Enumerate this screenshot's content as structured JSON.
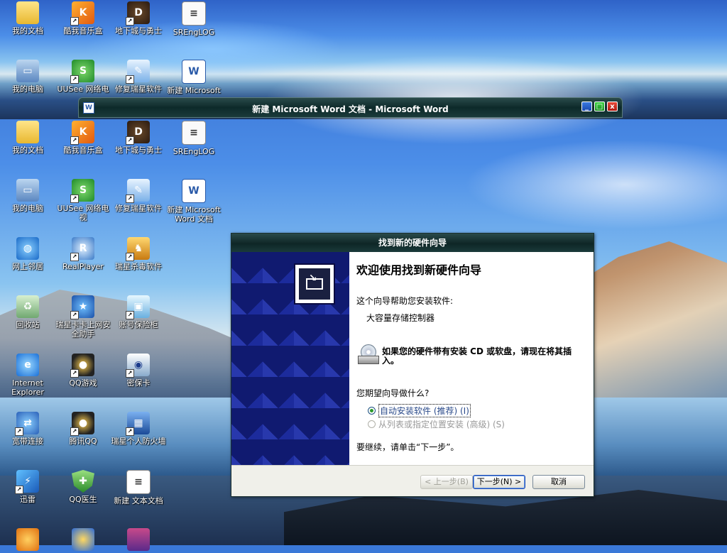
{
  "desktop_icons": [
    {
      "label": "我的文档",
      "icon": "folder-icon"
    },
    {
      "label": "酷我音乐盒",
      "icon": "music-box-icon"
    },
    {
      "label": "地下城与勇士",
      "icon": "game-icon"
    },
    {
      "label": "SREngLOG",
      "icon": "text-file-icon"
    },
    {
      "label": "我的电脑",
      "icon": "computer-icon"
    },
    {
      "label": "UUSee 网络电视",
      "icon": "uusee-icon"
    },
    {
      "label": "修复瑞星软件",
      "icon": "repair-icon"
    },
    {
      "label": "新建 Microsoft Word 文档",
      "icon": "word-doc-icon"
    },
    {
      "label": "网上邻居",
      "icon": "network-icon"
    },
    {
      "label": "RealPlayer",
      "icon": "realplayer-icon"
    },
    {
      "label": "瑞星杀毒软件",
      "icon": "antivirus-icon"
    },
    {
      "label": "回收站",
      "icon": "recycle-bin-icon"
    },
    {
      "label": "瑞星卡卡上网安全助手",
      "icon": "kaka-icon"
    },
    {
      "label": "账号保险柜",
      "icon": "account-safe-icon"
    },
    {
      "label": "Internet Explorer",
      "icon": "ie-icon"
    },
    {
      "label": "QQ游戏",
      "icon": "qq-game-icon"
    },
    {
      "label": "密保卡",
      "icon": "password-card-icon"
    },
    {
      "label": "宽带连接",
      "icon": "broadband-icon"
    },
    {
      "label": "腾讯QQ",
      "icon": "qq-icon"
    },
    {
      "label": "瑞星个人防火墙",
      "icon": "firewall-icon"
    },
    {
      "label": "迅雷",
      "icon": "thunder-icon"
    },
    {
      "label": "QQ医生",
      "icon": "qq-doctor-icon"
    },
    {
      "label": "新建 文本文档",
      "icon": "text-doc-icon"
    }
  ],
  "top_strip_icons": [
    {
      "label": "我的文档"
    },
    {
      "label": "酷我音乐盒"
    },
    {
      "label": "地下城与勇士"
    },
    {
      "label": "SREngLOG"
    },
    {
      "label": "我的电脑"
    },
    {
      "label": "UUSee 网络电"
    },
    {
      "label": "修复瑞星软件"
    },
    {
      "label": "新建 Microsoft"
    }
  ],
  "word_window": {
    "title": "新建 Microsoft Word 文档 - Microsoft Word",
    "min": "_",
    "max": "□",
    "close": "x"
  },
  "wizard": {
    "title": "找到新的硬件向导",
    "heading": "欢迎使用找到新硬件向导",
    "description": "这个向导帮助您安装软件:",
    "device": "大容量存储控制器",
    "insert_prompt": "如果您的硬件带有安装 CD 或软盘，请现在将其插入。",
    "question": "您期望向导做什么?",
    "options": [
      {
        "label": "自动安装软件 (推荐) (I)",
        "selected": true
      },
      {
        "label": "从列表或指定位置安装 (高级) (S)",
        "selected": false
      }
    ],
    "continue_hint": "要继续，请单击“下一步”。",
    "buttons": {
      "back": "< 上一步(B)",
      "next": "下一步(N) >",
      "cancel": "取消"
    }
  }
}
